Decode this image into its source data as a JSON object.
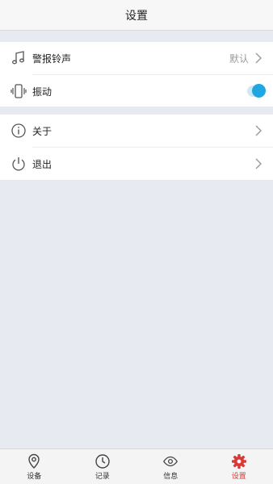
{
  "navbar": {
    "title": "设置"
  },
  "group1": [
    {
      "label": "警报铃声",
      "value": "默认",
      "icon": "music-note-icon",
      "control": "chevron"
    },
    {
      "label": "振动",
      "icon": "vibrate-phone-icon",
      "control": "toggle",
      "toggle_on": true
    }
  ],
  "group2": [
    {
      "label": "关于",
      "icon": "info-circle-icon",
      "control": "chevron"
    },
    {
      "label": "退出",
      "icon": "power-icon",
      "control": "chevron"
    }
  ],
  "tabs": [
    {
      "label": "设备",
      "icon": "location-pin-icon",
      "active": false
    },
    {
      "label": "记录",
      "icon": "clock-icon",
      "active": false
    },
    {
      "label": "信息",
      "icon": "eye-icon",
      "active": false
    },
    {
      "label": "设置",
      "icon": "gear-icon",
      "active": true
    }
  ],
  "colors": {
    "accent": "#1fa7e2",
    "active_tab": "#d83a3a",
    "background": "#e7eaf1"
  }
}
